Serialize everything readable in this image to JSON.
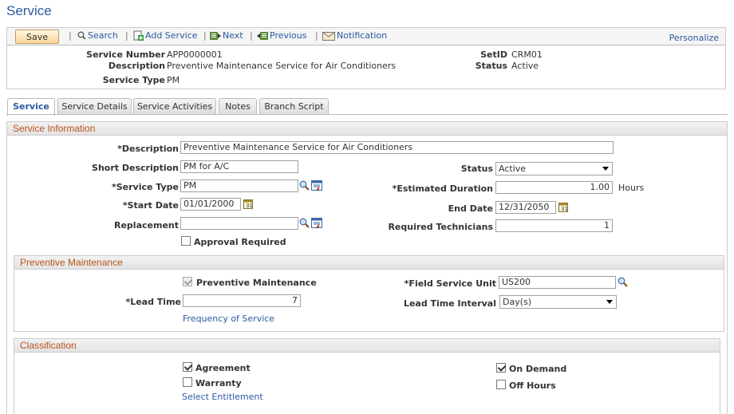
{
  "page": {
    "title": "Service"
  },
  "toolbar": {
    "save": "Save",
    "search": "Search",
    "add_service": "Add Service",
    "next": "Next",
    "previous": "Previous",
    "notification": "Notification",
    "personalize": "Personalize"
  },
  "header": {
    "service_number_label": "Service Number",
    "service_number": "APP0000001",
    "description_label": "Description",
    "description": "Preventive Maintenance Service for Air Conditioners",
    "service_type_label": "Service Type",
    "service_type": "PM",
    "setid_label": "SetID",
    "setid": "CRM01",
    "status_label": "Status",
    "status": "Active"
  },
  "tabs": [
    {
      "label": "Service",
      "active": true
    },
    {
      "label": "Service Details",
      "active": false
    },
    {
      "label": "Service Activities",
      "active": false
    },
    {
      "label": "Notes",
      "active": false
    },
    {
      "label": "Branch Script",
      "active": false
    }
  ],
  "service_info": {
    "title": "Service Information",
    "description_label": "*Description",
    "description": "Preventive Maintenance Service for Air Conditioners",
    "short_description_label": "Short Description",
    "short_description": "PM for A/C",
    "status_label": "Status",
    "status": "Active",
    "service_type_label": "*Service Type",
    "service_type": "PM",
    "estimated_duration_label": "*Estimated Duration",
    "estimated_duration": "1.00",
    "hours_label": "Hours",
    "start_date_label": "*Start Date",
    "start_date": "01/01/2000",
    "end_date_label": "End Date",
    "end_date": "12/31/2050",
    "replacement_label": "Replacement",
    "replacement": "",
    "required_technicians_label": "Required Technicians",
    "required_technicians": "1",
    "approval_required_label": "Approval Required",
    "approval_required": false
  },
  "preventive": {
    "title": "Preventive Maintenance",
    "pm_label": "Preventive Maintenance",
    "pm_checked": true,
    "field_service_unit_label": "*Field Service Unit",
    "field_service_unit": "US200",
    "lead_time_label": "*Lead Time",
    "lead_time": "7",
    "lead_time_interval_label": "Lead Time Interval",
    "lead_time_interval": "Day(s)",
    "frequency_link": "Frequency of Service"
  },
  "classification": {
    "title": "Classification",
    "agreement_label": "Agreement",
    "agreement": true,
    "warranty_label": "Warranty",
    "warranty": false,
    "on_demand_label": "On Demand",
    "on_demand": true,
    "off_hours_label": "Off Hours",
    "off_hours": false,
    "select_entitlement_link": "Select Entitlement"
  }
}
